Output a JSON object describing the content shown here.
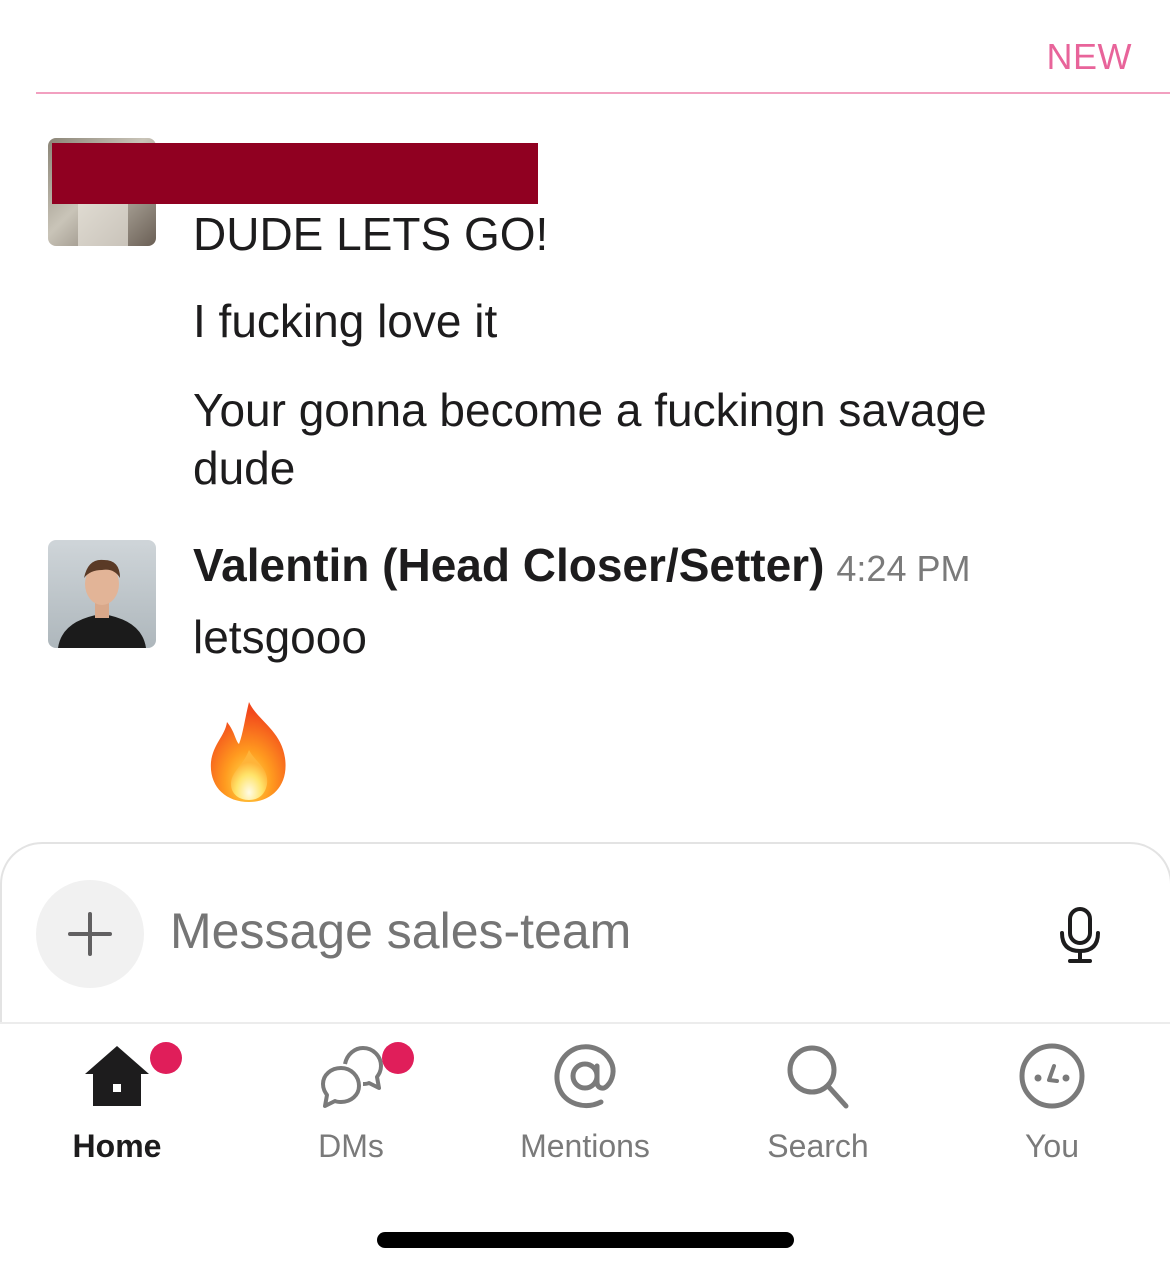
{
  "divider": {
    "label": "NEW"
  },
  "messages": [
    {
      "author": "",
      "time": "",
      "lines": [
        "DUDE LETS GO!",
        "I fucking love it",
        "Your gonna become a fuckingn savage dude"
      ]
    },
    {
      "author": "Valentin (Head Closer/Setter)",
      "time": "4:24 PM",
      "lines": [
        "letsgooo"
      ],
      "emoji": "fire"
    }
  ],
  "composer": {
    "placeholder": "Message sales-team",
    "add_icon": "plus-icon",
    "mic_icon": "microphone-icon"
  },
  "tabs": [
    {
      "label": "Home",
      "icon": "home-icon",
      "active": true,
      "badge": true
    },
    {
      "label": "DMs",
      "icon": "dms-icon",
      "active": false,
      "badge": true
    },
    {
      "label": "Mentions",
      "icon": "at-sign-icon",
      "active": false,
      "badge": false
    },
    {
      "label": "Search",
      "icon": "search-icon",
      "active": false,
      "badge": false
    },
    {
      "label": "You",
      "icon": "you-face-icon",
      "active": false,
      "badge": false
    }
  ],
  "colors": {
    "new_divider": "#e8649a",
    "badge": "#e01e5a",
    "redaction": "#900021"
  }
}
